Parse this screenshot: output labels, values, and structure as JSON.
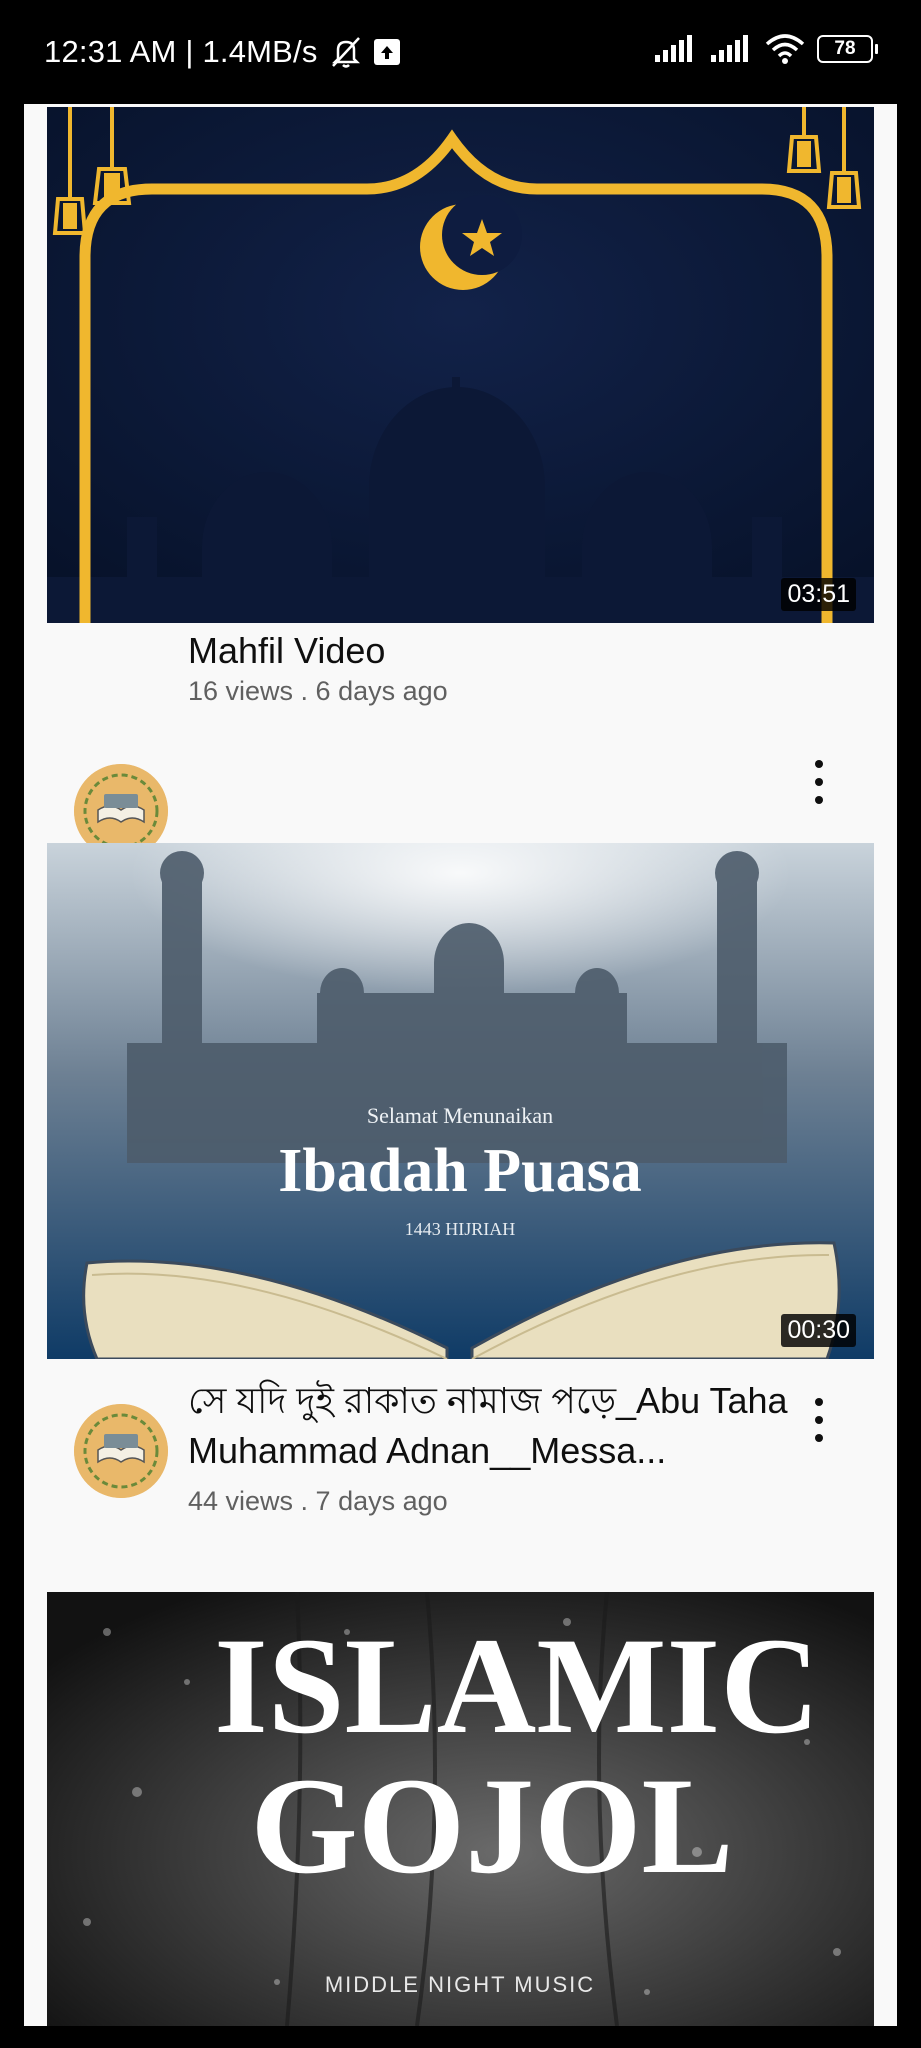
{
  "status": {
    "time_speed": "12:31 AM | 1.4MB/s",
    "battery": "78",
    "icons": [
      "mute-bell-icon",
      "upload-notification-icon",
      "signal-icon",
      "signal-icon",
      "wifi-icon",
      "battery-icon"
    ]
  },
  "videos": [
    {
      "title": "Mahfil Video",
      "meta": "16 views . 6 days ago",
      "duration": "03:51"
    },
    {
      "title": "সে যদি দুই রাকাত নামাজ পড়ে_Abu Taha Muhammad Adnan__Messa...",
      "meta": "44 views . 7 days ago",
      "duration": "00:30",
      "thumb_text": {
        "line1": "Selamat Menunaikan",
        "line2": "Ibadah Puasa",
        "line3": "1443 HIJRIAH"
      }
    },
    {
      "thumb_text": {
        "line1": "ISLAMIC",
        "line2": "GOJOL",
        "line3": "MIDDLE NIGHT MUSIC"
      }
    }
  ],
  "colors": {
    "panel_bg": "#f9f9f9",
    "title": "#0f0f0f",
    "meta": "#606060",
    "gold": "#f0b72e"
  }
}
